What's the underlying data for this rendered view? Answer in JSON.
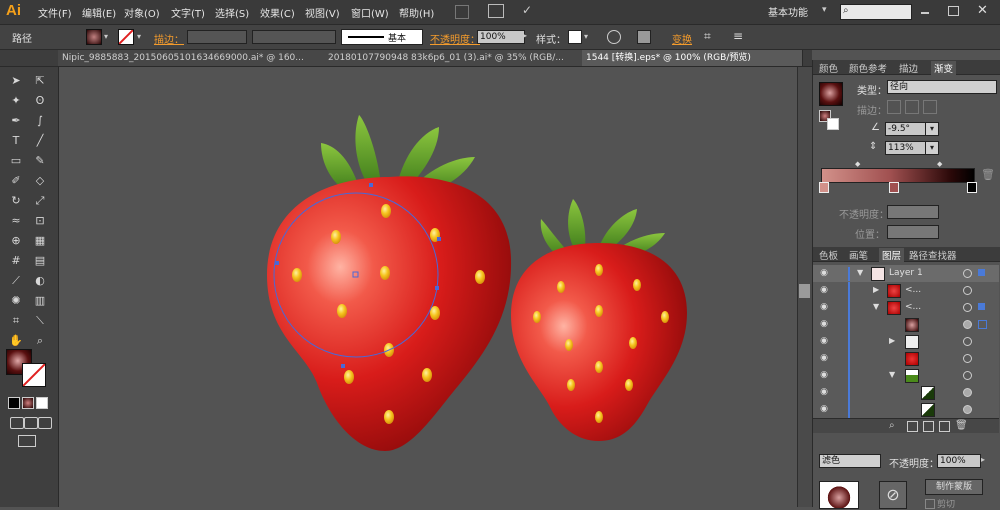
{
  "app": {
    "logo": "Ai",
    "workspace": "基本功能"
  },
  "menu": [
    "文件(F)",
    "编辑(E)",
    "对象(O)",
    "文字(T)",
    "选择(S)",
    "效果(C)",
    "视图(V)",
    "窗口(W)",
    "帮助(H)"
  ],
  "control_bar": {
    "selection_label": "路径",
    "stroke_label": "描边：",
    "stroke_style": "基本",
    "opacity_label": "不透明度：",
    "opacity_value": "100%",
    "style_label": "样式：",
    "transform_label": "变换"
  },
  "tabs": [
    {
      "label": "Nipic_9885883_20150605101634669000.ai* @ 160...",
      "active": false
    },
    {
      "label": "20180107790948 83k6p6_01 (3).ai* @ 35% (RGB/...",
      "active": false
    },
    {
      "label": "1544 [转换].eps* @ 100% (RGB/预览)",
      "active": true
    }
  ],
  "gradient_panel": {
    "tabs": [
      "颜色",
      "颜色参考",
      "描边",
      "渐变"
    ],
    "type_label": "类型：",
    "type_value": "径向",
    "stroke_label": "描边：",
    "angle_value": "-9.5°",
    "aspect_value": "113%",
    "opacity_label": "不透明度：",
    "location_label": "位置："
  },
  "layers_panel": {
    "tabs": [
      "色板",
      "画笔",
      "图层",
      "路径查找器"
    ],
    "layer_name": "Layer 1",
    "rows": [
      {
        "name": "Layer 1",
        "level": 0,
        "expanded": true
      },
      {
        "name": "<...",
        "level": 1,
        "expanded": false
      },
      {
        "name": "<...",
        "level": 1,
        "expanded": true
      },
      {
        "name": "",
        "level": 2,
        "expanded": false
      },
      {
        "name": "",
        "level": 2,
        "expanded": false
      },
      {
        "name": "",
        "level": 2,
        "expanded": false
      },
      {
        "name": "",
        "level": 2,
        "expanded": true
      },
      {
        "name": "",
        "level": 3,
        "expanded": false
      },
      {
        "name": "",
        "level": 3,
        "expanded": false
      }
    ]
  },
  "transparency_panel": {
    "blend_mode": "滤色",
    "opacity_label": "不透明度：",
    "opacity_value": "100%",
    "make_mask_label": "制作蒙版",
    "clip_label": "剪切"
  },
  "colors": {
    "accent_orange": "#f39b2c",
    "strawberry_red": "#e0201e",
    "leaf_green": "#6aa22c",
    "seed_yellow": "#f5c422"
  }
}
